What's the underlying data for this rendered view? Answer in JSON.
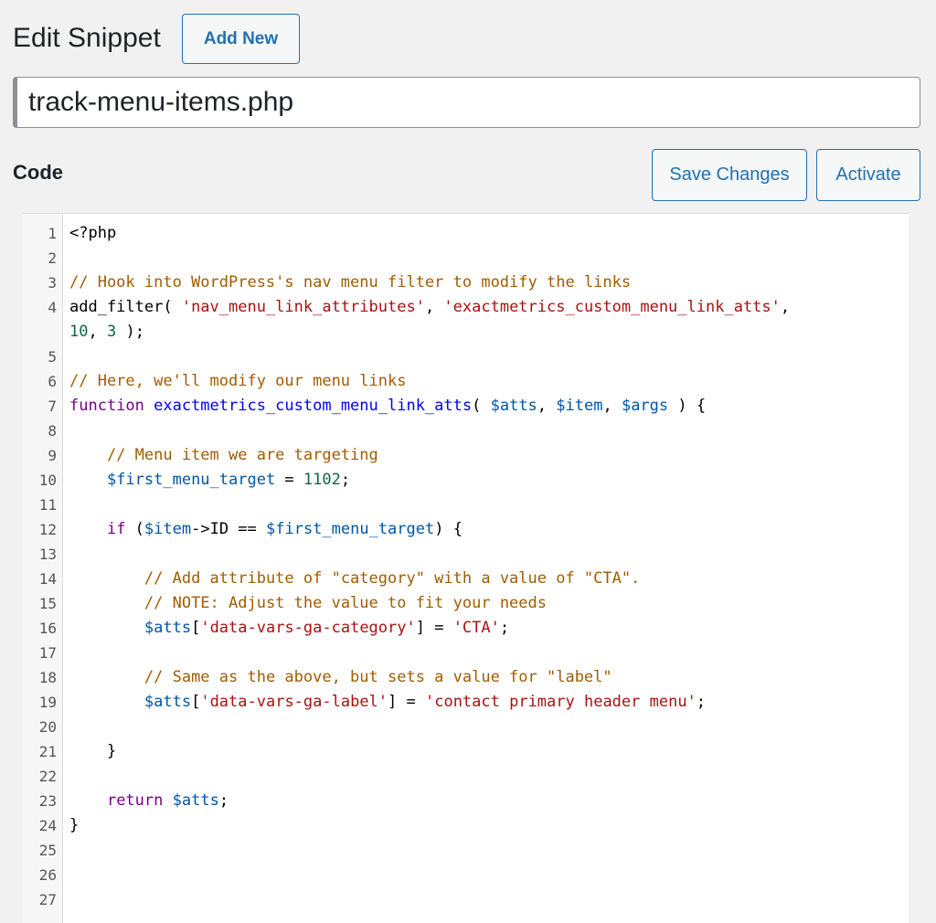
{
  "page": {
    "title": "Edit Snippet",
    "add_new_label": "Add New",
    "snippet_title": "track-menu-items.php",
    "code_label": "Code",
    "save_label": "Save Changes",
    "activate_label": "Activate"
  },
  "editor": {
    "lines": [
      {
        "n": "1",
        "parts": [
          [
            "",
            "<?php"
          ]
        ]
      },
      {
        "n": "2",
        "parts": []
      },
      {
        "n": "3",
        "parts": [
          [
            "comment",
            "// Hook into WordPress's nav menu filter to modify the links"
          ]
        ]
      },
      {
        "n": "4",
        "parts": [
          [
            "",
            "add_filter( "
          ],
          [
            "str",
            "'nav_menu_link_attributes'"
          ],
          [
            "",
            ", "
          ],
          [
            "str",
            "'exactmetrics_custom_menu_link_atts'"
          ],
          [
            "",
            ","
          ]
        ]
      },
      {
        "n": "",
        "parts": [
          [
            "num",
            "10"
          ],
          [
            "",
            ", "
          ],
          [
            "num",
            "3"
          ],
          [
            "",
            " );"
          ]
        ]
      },
      {
        "n": "5",
        "parts": []
      },
      {
        "n": "6",
        "parts": [
          [
            "comment",
            "// Here, we'll modify our menu links"
          ]
        ]
      },
      {
        "n": "7",
        "parts": [
          [
            "kw",
            "function "
          ],
          [
            "def",
            "exactmetrics_custom_menu_link_atts"
          ],
          [
            "",
            "( "
          ],
          [
            "var",
            "$atts"
          ],
          [
            "",
            ", "
          ],
          [
            "var",
            "$item"
          ],
          [
            "",
            ", "
          ],
          [
            "var",
            "$args"
          ],
          [
            "",
            " ) {"
          ]
        ]
      },
      {
        "n": "8",
        "parts": []
      },
      {
        "n": "9",
        "parts": [
          [
            "",
            "    "
          ],
          [
            "comment",
            "// Menu item we are targeting"
          ]
        ]
      },
      {
        "n": "10",
        "parts": [
          [
            "",
            "    "
          ],
          [
            "var",
            "$first_menu_target"
          ],
          [
            "",
            " = "
          ],
          [
            "num",
            "1102"
          ],
          [
            "",
            ";"
          ]
        ]
      },
      {
        "n": "11",
        "parts": []
      },
      {
        "n": "12",
        "parts": [
          [
            "",
            "    "
          ],
          [
            "kw",
            "if"
          ],
          [
            "",
            " ("
          ],
          [
            "var",
            "$item"
          ],
          [
            "",
            "->ID == "
          ],
          [
            "var",
            "$first_menu_target"
          ],
          [
            "",
            ") {"
          ]
        ]
      },
      {
        "n": "13",
        "parts": []
      },
      {
        "n": "14",
        "parts": [
          [
            "",
            "        "
          ],
          [
            "comment",
            "// Add attribute of \"category\" with a value of \"CTA\"."
          ]
        ]
      },
      {
        "n": "15",
        "parts": [
          [
            "",
            "        "
          ],
          [
            "comment",
            "// NOTE: Adjust the value to fit your needs"
          ]
        ]
      },
      {
        "n": "16",
        "parts": [
          [
            "",
            "        "
          ],
          [
            "var",
            "$atts"
          ],
          [
            "",
            "["
          ],
          [
            "str",
            "'data-vars-ga-category'"
          ],
          [
            "",
            "] = "
          ],
          [
            "str",
            "'CTA'"
          ],
          [
            "",
            ";"
          ]
        ]
      },
      {
        "n": "17",
        "parts": []
      },
      {
        "n": "18",
        "parts": [
          [
            "",
            "        "
          ],
          [
            "comment",
            "// Same as the above, but sets a value for \"label\""
          ]
        ]
      },
      {
        "n": "19",
        "parts": [
          [
            "",
            "        "
          ],
          [
            "var",
            "$atts"
          ],
          [
            "",
            "["
          ],
          [
            "str",
            "'data-vars-ga-label'"
          ],
          [
            "",
            "] = "
          ],
          [
            "str",
            "'contact primary header menu'"
          ],
          [
            "",
            ";"
          ]
        ]
      },
      {
        "n": "20",
        "parts": []
      },
      {
        "n": "21",
        "parts": [
          [
            "",
            "    }"
          ]
        ]
      },
      {
        "n": "22",
        "parts": []
      },
      {
        "n": "23",
        "parts": [
          [
            "",
            "    "
          ],
          [
            "kw",
            "return"
          ],
          [
            "",
            " "
          ],
          [
            "var",
            "$atts"
          ],
          [
            "",
            ";"
          ]
        ]
      },
      {
        "n": "24",
        "parts": [
          [
            "",
            "}"
          ]
        ]
      },
      {
        "n": "25",
        "parts": []
      },
      {
        "n": "26",
        "parts": []
      },
      {
        "n": "27",
        "parts": []
      }
    ]
  }
}
